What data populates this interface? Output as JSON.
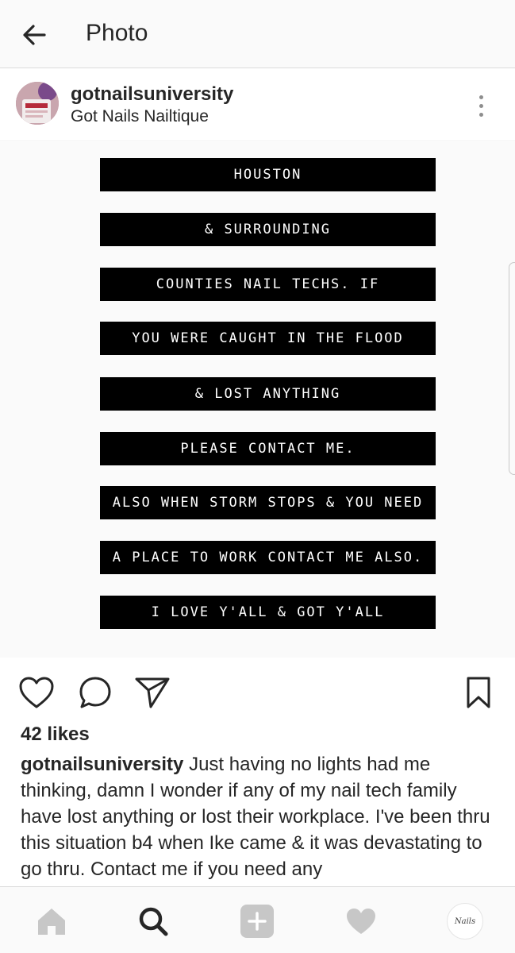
{
  "header": {
    "title": "Photo",
    "back_icon": "arrow-left-icon"
  },
  "post": {
    "username": "gotnailsuniversity",
    "location": "Got Nails Nailtique",
    "more_icon": "more-vertical-icon",
    "image_lines": [
      "HOUSTON",
      "& SURROUNDING",
      "COUNTIES NAIL TECHS. IF",
      "YOU WERE CAUGHT IN THE FLOOD",
      "& LOST ANYTHING",
      "PLEASE CONTACT ME.",
      "ALSO WHEN STORM STOPS & YOU NEED",
      "A PLACE TO WORK CONTACT ME ALSO.",
      "I LOVE Y'ALL & GOT Y'ALL"
    ],
    "likes": "42 likes",
    "caption_user": "gotnailsuniversity",
    "caption_text": "Just having no lights had me thinking, damn I wonder if any of my nail tech family have lost anything or lost their workplace. I've been thru this situation b4 when Ike came & it was devastating to go thru. Contact me if you need any"
  },
  "actions": {
    "like_icon": "heart-outline-icon",
    "comment_icon": "comment-bubble-icon",
    "share_icon": "paper-plane-icon",
    "save_icon": "bookmark-icon"
  },
  "bottom_nav": {
    "items": [
      "home-icon",
      "search-icon",
      "add-post-icon",
      "activity-heart-icon",
      "profile-avatar"
    ],
    "profile_logo_text": "Nails"
  },
  "colors": {
    "text": "#262626",
    "inactive_icon": "#c7c7c7",
    "bar_background": "#000000",
    "bar_text": "#ffffff"
  }
}
